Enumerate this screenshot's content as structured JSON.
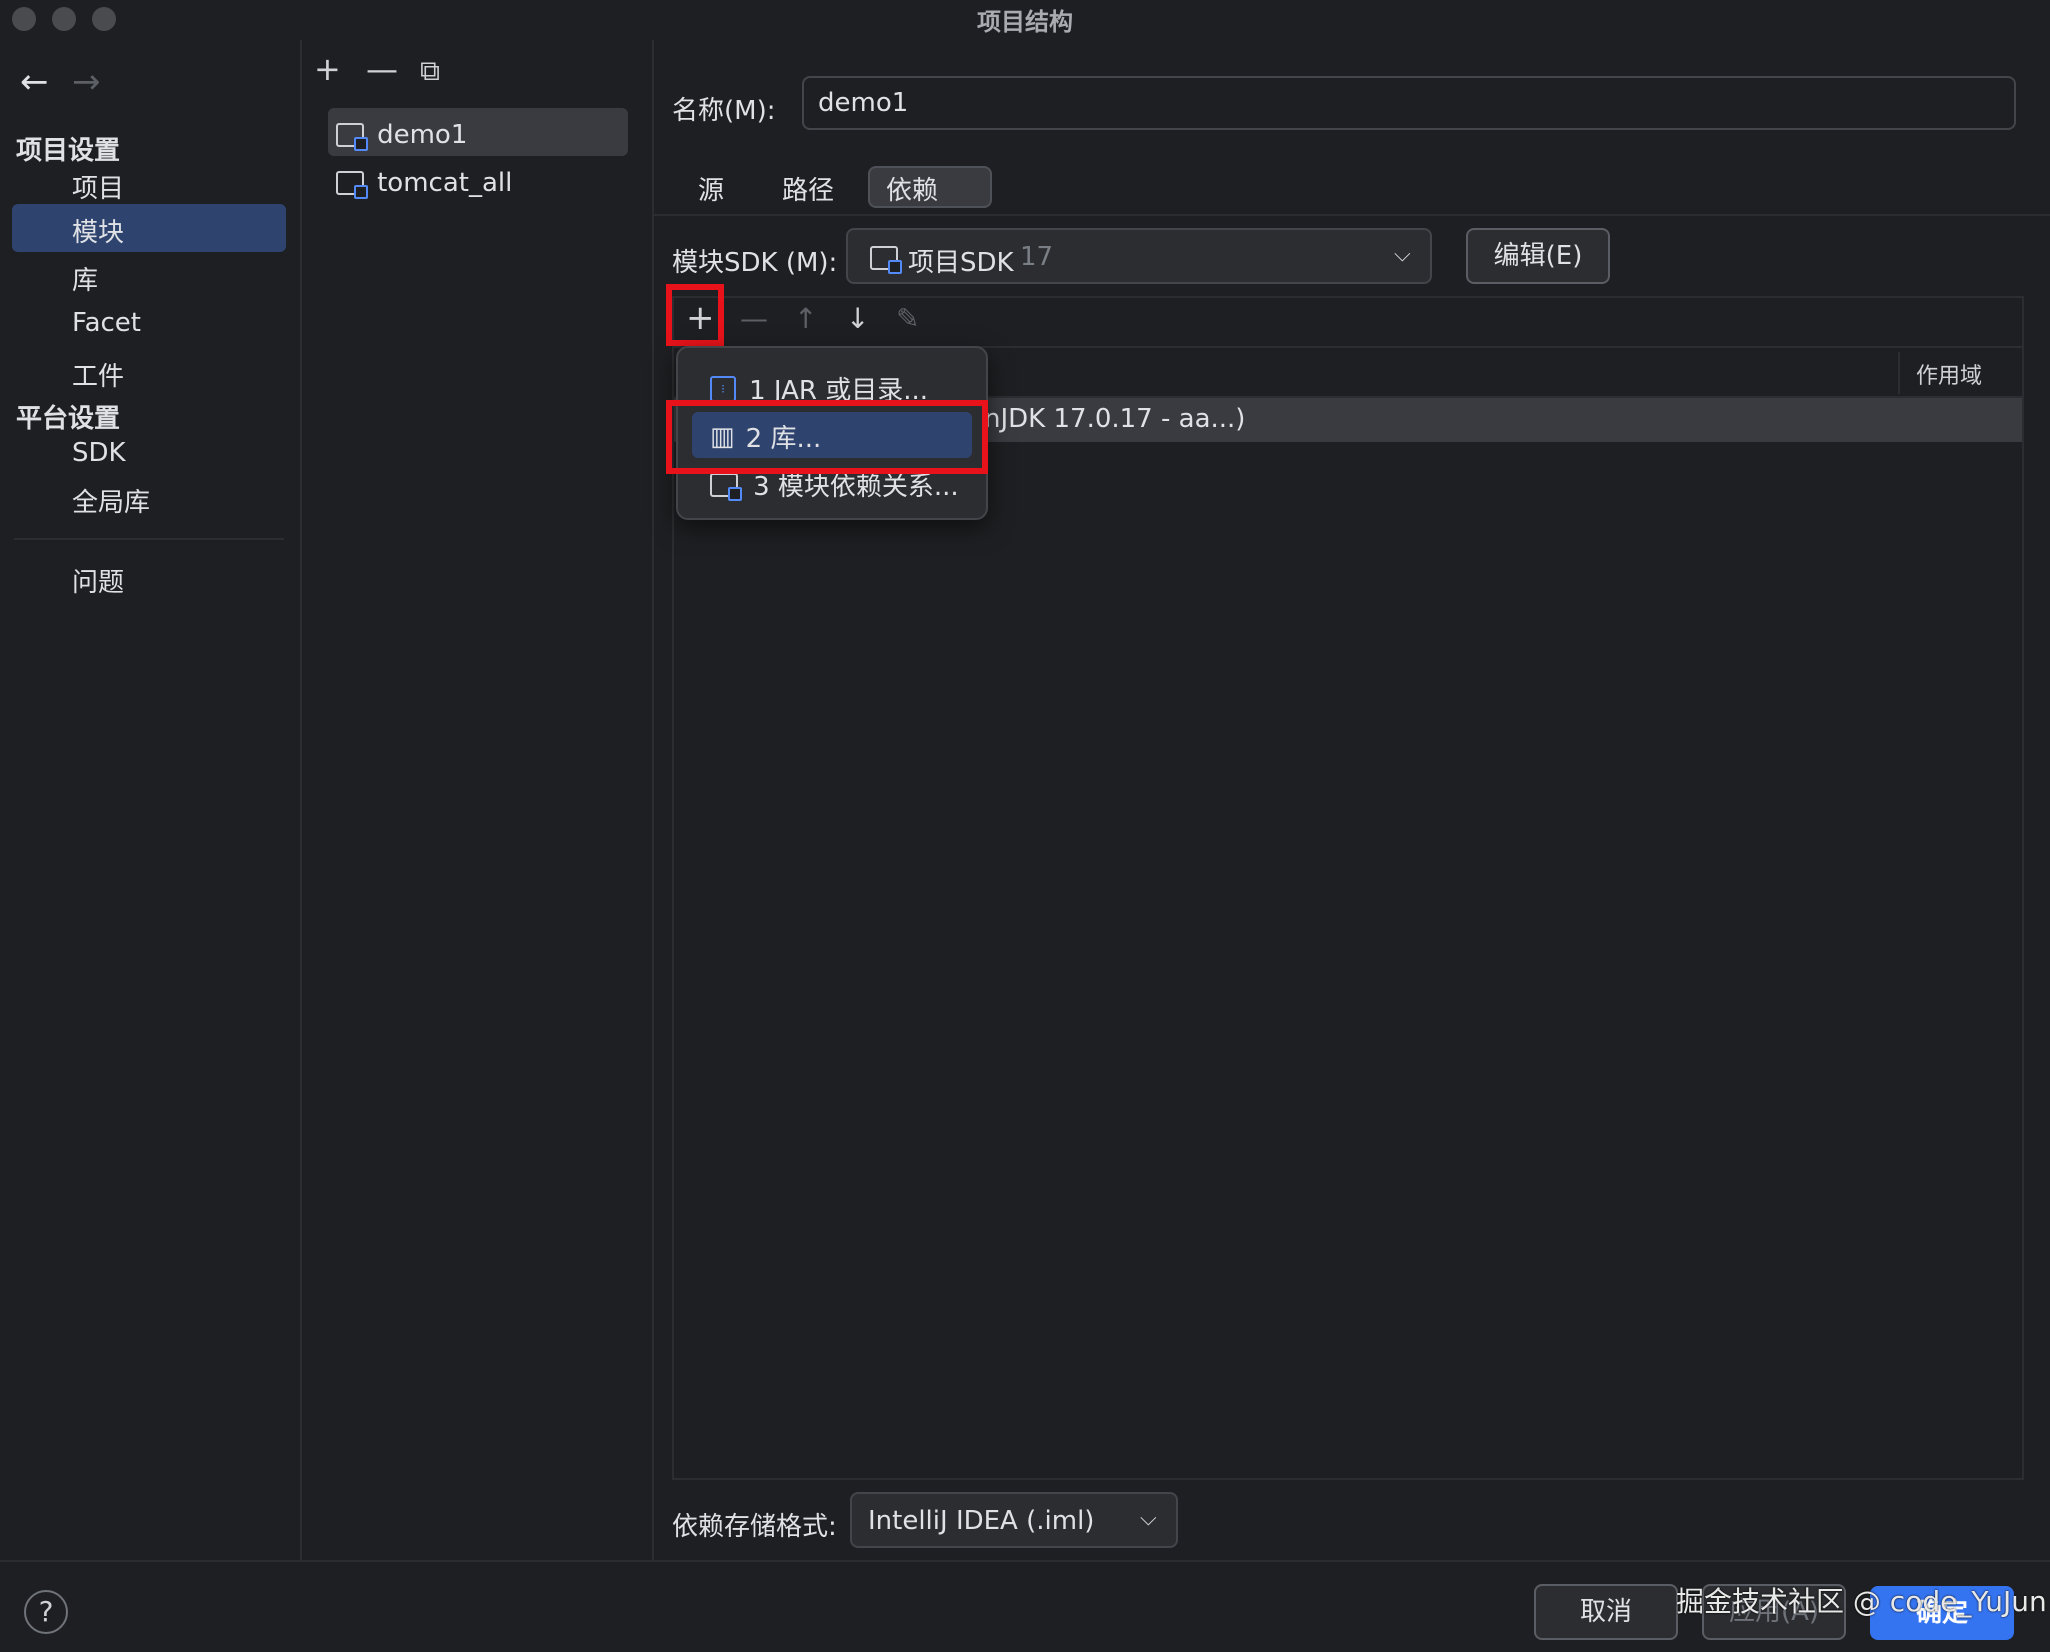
{
  "window": {
    "title": "项目结构"
  },
  "nav": {
    "back_icon": "←",
    "forward_icon": "→",
    "project_settings_header": "项目设置",
    "project_items": [
      "项目",
      "模块",
      "库",
      "Facet",
      "工件"
    ],
    "platform_settings_header": "平台设置",
    "platform_items": [
      "SDK",
      "全局库"
    ],
    "problems": "问题",
    "selected": "模块"
  },
  "modules": {
    "toolbar": {
      "add": "+",
      "remove": "—",
      "copy": "⧉"
    },
    "items": [
      "demo1",
      "tomcat_all"
    ],
    "selected": "demo1"
  },
  "detail": {
    "name_label": "名称(M):",
    "name_value": "demo1",
    "tabs": [
      "源",
      "路径",
      "依赖"
    ],
    "active_tab": "依赖",
    "sdk_label": "模块SDK (M):",
    "sdk_value": "项目SDK",
    "sdk_version": "17",
    "edit_button": "编辑(E)",
    "dep_toolbar": {
      "add": "+",
      "remove": "—",
      "up": "↑",
      "down": "↓",
      "edit": "✎"
    },
    "scope_header": "作用域",
    "row_text": "nJDK 17.0.17 - aa...)",
    "storage_label": "依赖存储格式:",
    "storage_value": "IntelliJ IDEA (.iml)"
  },
  "popup": {
    "items": [
      {
        "label": "1  JAR 或目录...",
        "icon": "jar-icon"
      },
      {
        "label": "2  库...",
        "icon": "library-icon"
      },
      {
        "label": "3  模块依赖关系...",
        "icon": "module-icon"
      }
    ],
    "selected_index": 1
  },
  "footer": {
    "help": "?",
    "cancel": "取消",
    "apply": "应用(A)",
    "ok": "确定"
  },
  "watermark": "掘金技术社区 @ code_YuJun",
  "colors": {
    "accent": "#3574f0",
    "selection": "#2e436e",
    "highlight_box": "#e8131a",
    "background": "#1e1f22"
  }
}
